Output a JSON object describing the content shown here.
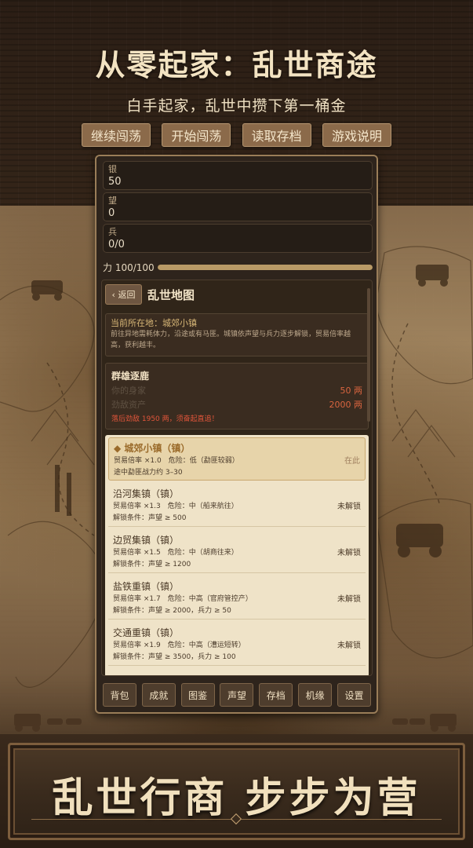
{
  "header": {
    "title": "从零起家：乱世商途",
    "subtitle": "白手起家，乱世中攒下第一桶金"
  },
  "menu": [
    {
      "label": "继续闯荡"
    },
    {
      "label": "开始闯荡"
    },
    {
      "label": "读取存档"
    },
    {
      "label": "游戏说明"
    }
  ],
  "stats": {
    "silver": {
      "label": "银",
      "value": "50"
    },
    "reputation": {
      "label": "望",
      "value": "0"
    },
    "soldiers": {
      "label": "兵",
      "value": "0/0"
    },
    "strength": {
      "label": "力 100/100",
      "progress": 1.0
    }
  },
  "map_panel": {
    "back_label": "‹ 返回",
    "title": "乱世地图",
    "current_location": "当前所在地：城郊小镇",
    "description": "前往异地需耗体力，沿途或有马匪。城镇依声望与兵力逐步解锁，贸易倍率越高，获利越丰。"
  },
  "rival": {
    "title": "群雄逐鹿",
    "rows": [
      {
        "key": "你的身家",
        "value": "50 两"
      },
      {
        "key": "劲敌资产",
        "value": "2000 两"
      }
    ],
    "warning": "落后劲敌 1950 两，须奋起直追！"
  },
  "towns": [
    {
      "name": "◆ 城郊小镇（镇）",
      "line1": "贸易倍率 ×1.0　危险：低（勐匪较弱）",
      "line2": "途中勐匪战力约 3–30",
      "status": "在此"
    },
    {
      "name": "沿河集镇（镇）",
      "line1": "贸易倍率 ×1.3　危险：中（船来航往）",
      "line2": "解锁条件：声望 ≥ 500",
      "status": "未解锁"
    },
    {
      "name": "边贸集镇（镇）",
      "line1": "贸易倍率 ×1.5　危险：中（胡商往来）",
      "line2": "解锁条件：声望 ≥ 1200",
      "status": "未解锁"
    },
    {
      "name": "盐铁重镇（镇）",
      "line1": "贸易倍率 ×1.7　危险：中高（官府管控产）",
      "line2": "解锁条件：声望 ≥ 2000，兵力 ≥ 50",
      "status": "未解锁"
    },
    {
      "name": "交通重镇（镇）",
      "line1": "贸易倍率 ×1.9　危险：中高（漕运短转）",
      "line2": "解锁条件：声望 ≥ 3500，兵力 ≥ 100",
      "status": "未解锁"
    }
  ],
  "tabs": [
    {
      "label": "背包"
    },
    {
      "label": "成就"
    },
    {
      "label": "图鉴"
    },
    {
      "label": "声望"
    },
    {
      "label": "存档"
    },
    {
      "label": "机缘"
    },
    {
      "label": "设置"
    }
  ],
  "banner": {
    "slogan": "乱世行商 步步为营"
  }
}
